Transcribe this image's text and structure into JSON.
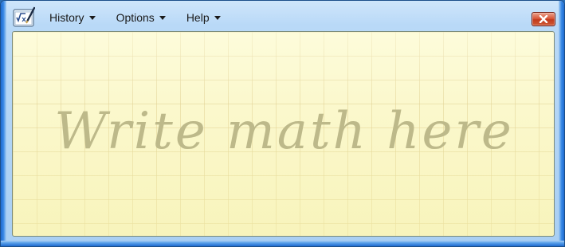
{
  "app": {
    "icon_name": "math-input-panel-icon"
  },
  "menubar": {
    "items": [
      {
        "label": "History"
      },
      {
        "label": "Options"
      },
      {
        "label": "Help"
      }
    ]
  },
  "window_controls": {
    "close_icon": "close-icon"
  },
  "canvas": {
    "hint_text": "Write math here",
    "background_color": "#fbf8cd",
    "hint_color": "#bdb98a"
  },
  "colors": {
    "frame": "#a9cff3",
    "close_button": "#c23a1c"
  }
}
